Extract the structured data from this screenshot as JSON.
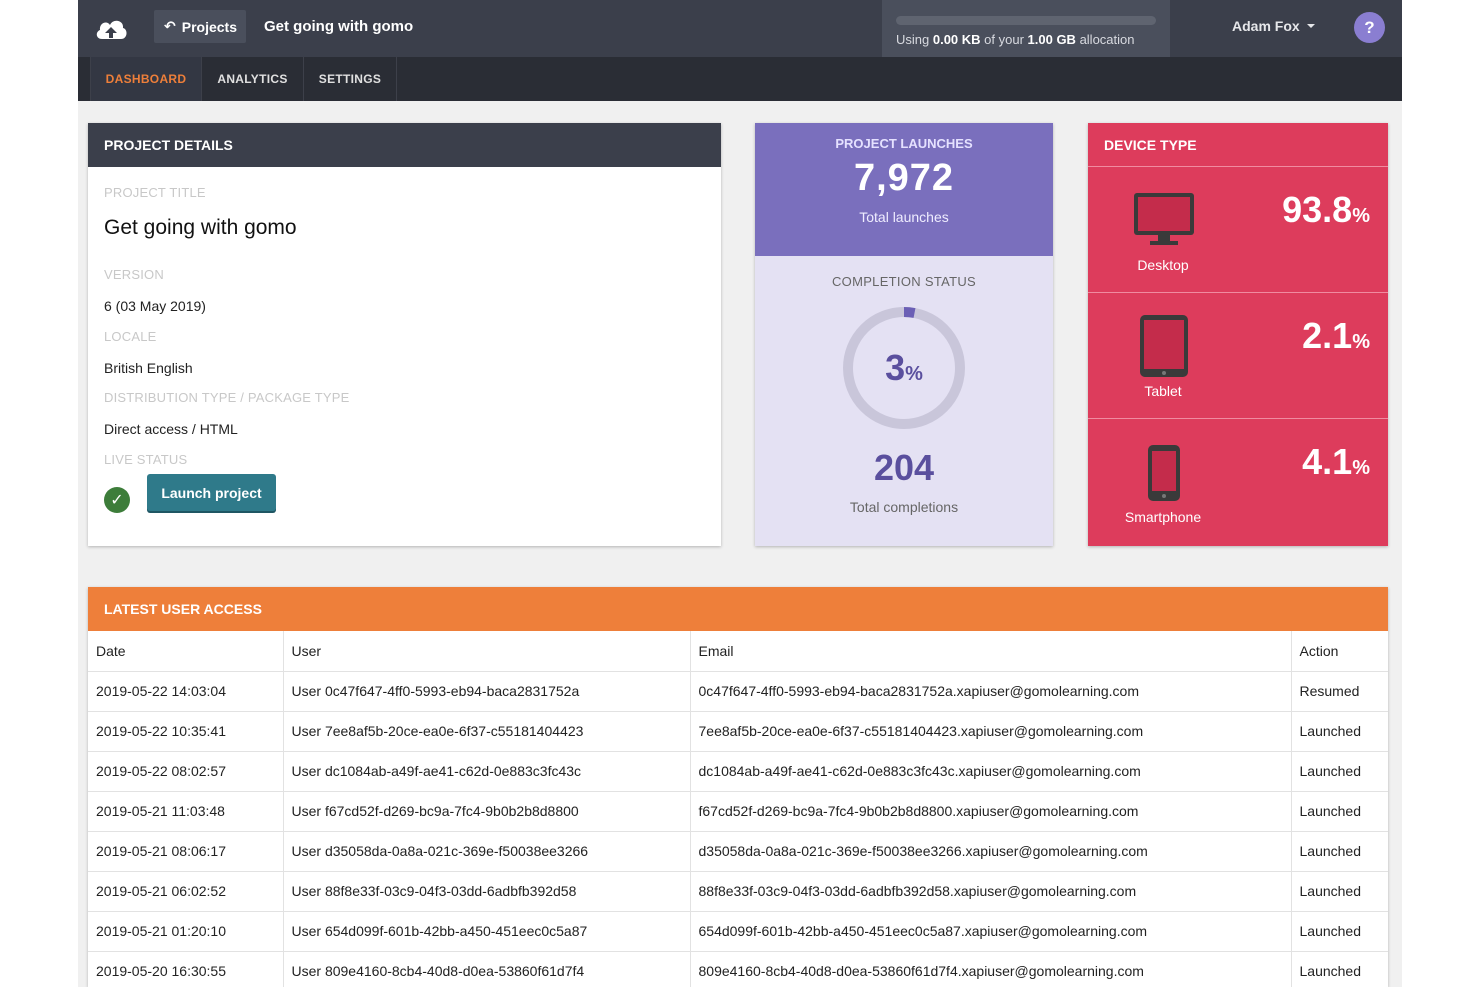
{
  "header": {
    "projects_label": "Projects",
    "project_name": "Get going with gomo",
    "storage": {
      "prefix": "Using ",
      "used": "0.00 KB",
      "middle": " of your ",
      "total": "1.00 GB",
      "suffix": " allocation",
      "used_fraction": 0.0
    },
    "user_name": "Adam Fox",
    "help_label": "?"
  },
  "nav": {
    "tabs": [
      {
        "label": "DASHBOARD",
        "active": true
      },
      {
        "label": "ANALYTICS",
        "active": false
      },
      {
        "label": "SETTINGS",
        "active": false
      }
    ]
  },
  "details": {
    "heading": "PROJECT DETAILS",
    "fields": [
      {
        "label": "PROJECT TITLE",
        "value": "Get going with gomo"
      },
      {
        "label": "VERSION",
        "value": "6 (03 May 2019)"
      },
      {
        "label": "LOCALE",
        "value": "British English"
      },
      {
        "label": "DISTRIBUTION TYPE / PACKAGE TYPE",
        "value": "Direct access / HTML"
      },
      {
        "label": "LIVE STATUS",
        "value": ""
      }
    ],
    "launch_button": "Launch project"
  },
  "launches": {
    "label": "PROJECT LAUNCHES",
    "total": "7,972",
    "sub": "Total launches",
    "completion_label": "COMPLETION STATUS",
    "completion_pct": "3",
    "completion_fraction": 0.03,
    "pct_sign": "%",
    "completions": "204",
    "completions_sub": "Total completions"
  },
  "device": {
    "heading": "DEVICE TYPE",
    "items": [
      {
        "name": "Desktop",
        "pct": "93.8",
        "icon": "desktop-icon"
      },
      {
        "name": "Tablet",
        "pct": "2.1",
        "icon": "tablet-icon"
      },
      {
        "name": "Smartphone",
        "pct": "4.1",
        "icon": "smartphone-icon"
      }
    ],
    "pct_sign": "%"
  },
  "access": {
    "heading": "LATEST USER ACCESS",
    "columns": [
      "Date",
      "User",
      "Email",
      "Action"
    ],
    "rows": [
      [
        "2019-05-22 14:03:04",
        "User 0c47f647-4ff0-5993-eb94-baca2831752a",
        "0c47f647-4ff0-5993-eb94-baca2831752a.xapiuser@gomolearning.com",
        "Resumed"
      ],
      [
        "2019-05-22 10:35:41",
        "User 7ee8af5b-20ce-ea0e-6f37-c55181404423",
        "7ee8af5b-20ce-ea0e-6f37-c55181404423.xapiuser@gomolearning.com",
        "Launched"
      ],
      [
        "2019-05-22 08:02:57",
        "User dc1084ab-a49f-ae41-c62d-0e883c3fc43c",
        "dc1084ab-a49f-ae41-c62d-0e883c3fc43c.xapiuser@gomolearning.com",
        "Launched"
      ],
      [
        "2019-05-21 11:03:48",
        "User f67cd52f-d269-bc9a-7fc4-9b0b2b8d8800",
        "f67cd52f-d269-bc9a-7fc4-9b0b2b8d8800.xapiuser@gomolearning.com",
        "Launched"
      ],
      [
        "2019-05-21 08:06:17",
        "User d35058da-0a8a-021c-369e-f50038ee3266",
        "d35058da-0a8a-021c-369e-f50038ee3266.xapiuser@gomolearning.com",
        "Launched"
      ],
      [
        "2019-05-21 06:02:52",
        "User 88f8e33f-03c9-04f3-03dd-6adbfb392d58",
        "88f8e33f-03c9-04f3-03dd-6adbfb392d58.xapiuser@gomolearning.com",
        "Launched"
      ],
      [
        "2019-05-21 01:20:10",
        "User 654d099f-601b-42bb-a450-451eec0c5a87",
        "654d099f-601b-42bb-a450-451eec0c5a87.xapiuser@gomolearning.com",
        "Launched"
      ],
      [
        "2019-05-20 16:30:55",
        "User 809e4160-8cb4-40d8-d0ea-53860f61d7f4",
        "809e4160-8cb4-40d8-d0ea-53860f61d7f4.xapiuser@gomolearning.com",
        "Launched"
      ]
    ]
  },
  "colors": {
    "topbar": "#3b3f4b",
    "accent_orange": "#ee7f3a",
    "purple": "#7a6fbd",
    "device_red": "#dd3c5c",
    "launch_button": "#2f7a8a",
    "status_green": "#3d7d3a"
  }
}
